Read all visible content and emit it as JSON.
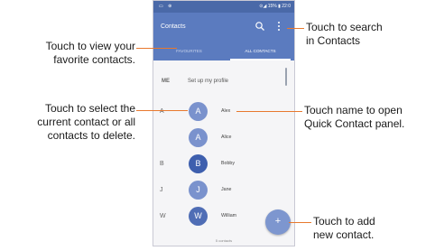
{
  "status_bar": {
    "left": "▭ ⊛",
    "right": "⊙◢ 15% ▮ 22:0"
  },
  "app_bar": {
    "title": "Contacts"
  },
  "tabs": {
    "favourites": "FAVOURITES",
    "all": "ALL CONTACTS"
  },
  "profile": {
    "me_label": "ME",
    "setup": "Set up my profile"
  },
  "contacts": [
    {
      "letter": "A",
      "initial": "A",
      "name": "Alex",
      "color": "#7a92cd"
    },
    {
      "letter": "",
      "initial": "A",
      "name": "Alice",
      "color": "#7a92cd"
    },
    {
      "letter": "B",
      "initial": "B",
      "name": "Bobby",
      "color": "#3e5fae"
    },
    {
      "letter": "J",
      "initial": "J",
      "name": "Jane",
      "color": "#7a92cd"
    },
    {
      "letter": "W",
      "initial": "W",
      "name": "William",
      "color": "#4f6db5"
    }
  ],
  "footer": {
    "count": "5 contacts"
  },
  "fab": {
    "label": "+"
  },
  "callouts": {
    "search": [
      "Touch to search",
      "in Contacts"
    ],
    "favorites": [
      "Touch to view your",
      "favorite contacts."
    ],
    "select": [
      "Touch to select the",
      "current contact or all",
      "contacts to delete."
    ],
    "quick": [
      "Touch name to open",
      "Quick Contact panel."
    ],
    "add": [
      "Touch to add",
      "new contact."
    ]
  },
  "accent_color": "#e8792e",
  "brand_color": "#5b7bbf"
}
